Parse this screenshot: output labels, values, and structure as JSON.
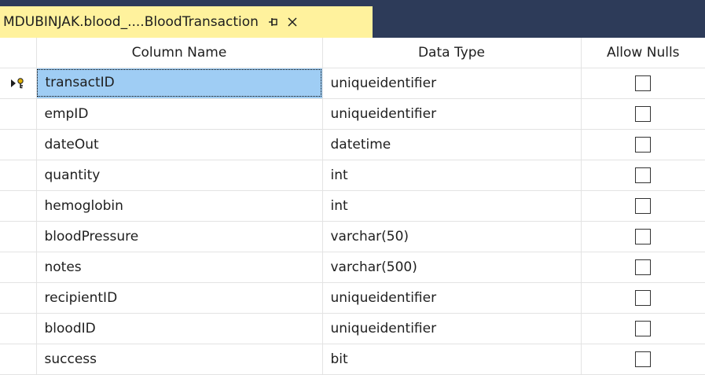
{
  "tab": {
    "title": "MDUBINJAK.blood_....BloodTransaction",
    "pin_glyph": "⊣",
    "close_glyph": "✕"
  },
  "columns": {
    "name": "Column Name",
    "type": "Data Type",
    "nulls": "Allow Nulls"
  },
  "rows": [
    {
      "name": "transactID",
      "type": "uniqueidentifier",
      "allow_nulls": false
    },
    {
      "name": "empID",
      "type": "uniqueidentifier",
      "allow_nulls": false
    },
    {
      "name": "dateOut",
      "type": "datetime",
      "allow_nulls": false
    },
    {
      "name": "quantity",
      "type": "int",
      "allow_nulls": false
    },
    {
      "name": "hemoglobin",
      "type": "int",
      "allow_nulls": false
    },
    {
      "name": "bloodPressure",
      "type": "varchar(50)",
      "allow_nulls": false
    },
    {
      "name": "notes",
      "type": "varchar(500)",
      "allow_nulls": false
    },
    {
      "name": "recipientID",
      "type": "uniqueidentifier",
      "allow_nulls": false
    },
    {
      "name": "bloodID",
      "type": "uniqueidentifier",
      "allow_nulls": false
    },
    {
      "name": "success",
      "type": "bit",
      "allow_nulls": false
    }
  ],
  "icons": {
    "row_marker": "primary-key-current-row-icon"
  },
  "colors": {
    "tab_active": "#fff29d",
    "tab_bar": "#2d3b59",
    "selection": "#9fcdf4"
  }
}
